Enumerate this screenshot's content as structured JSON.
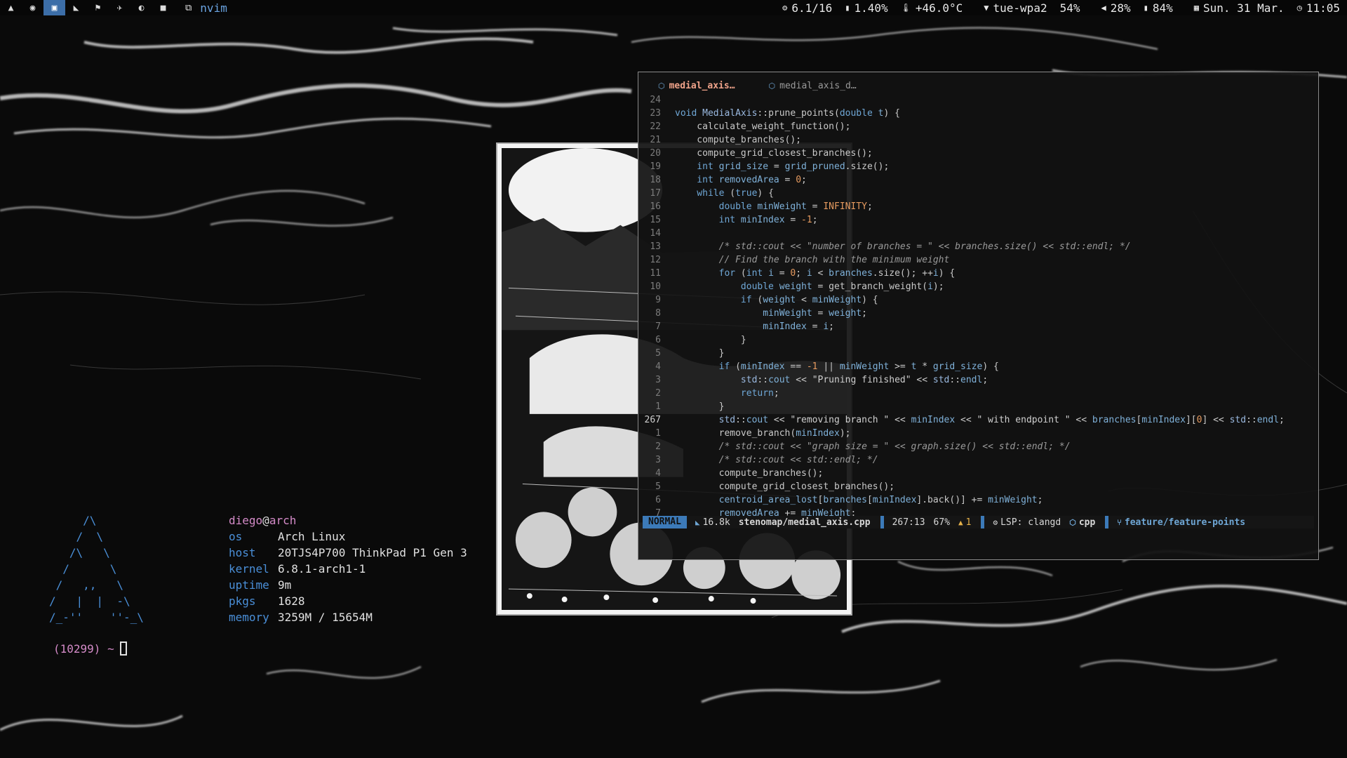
{
  "topbar": {
    "workspaces": [
      {
        "icon": "arch-icon",
        "glyph": "▲",
        "active": false
      },
      {
        "icon": "browser-icon",
        "glyph": "◉",
        "active": false
      },
      {
        "icon": "terminal-icon",
        "glyph": "▣",
        "active": true
      },
      {
        "icon": "kite-icon",
        "glyph": "◣",
        "active": false
      },
      {
        "icon": "flag-icon",
        "glyph": "⚑",
        "active": false
      },
      {
        "icon": "plane-icon",
        "glyph": "✈",
        "active": false
      },
      {
        "icon": "circle-icon",
        "glyph": "◐",
        "active": false
      },
      {
        "icon": "lock-icon",
        "glyph": "■",
        "active": false
      }
    ],
    "window_icon": "⧉",
    "title": "nvim",
    "modules": {
      "load": "6.1/16",
      "cpu": "1.40%",
      "temp": "+46.0°C",
      "wifi": "tue-wpa2",
      "wifi_strength": "54%",
      "volume": "28%",
      "battery": "84%",
      "date": "Sun. 31 Mar.",
      "time": "11:05"
    }
  },
  "neofetch": {
    "logo": "     /\\\n    /  \\\n   /\\   \\\n  /      \\\n /   ,,   \\\n/   |  |  -\\\n/_-''    ''-_\\",
    "user": "diego",
    "at": "@",
    "host_name": "arch",
    "rows": [
      {
        "key": "os",
        "value": "Arch Linux"
      },
      {
        "key": "host",
        "value": "20TJS4P700 ThinkPad P1 Gen 3"
      },
      {
        "key": "kernel",
        "value": "6.8.1-arch1-1"
      },
      {
        "key": "uptime",
        "value": "9m"
      },
      {
        "key": "pkgs",
        "value": "1628"
      },
      {
        "key": "memory",
        "value": "3259M / 15654M"
      }
    ]
  },
  "prompt": {
    "text": "(10299) ~"
  },
  "nvim": {
    "tabs": [
      {
        "label": "medial_axis…",
        "active": true
      },
      {
        "label": "medial_axis_d…",
        "active": false
      }
    ],
    "lines": [
      {
        "n": "24",
        "cur": false,
        "seg": []
      },
      {
        "n": "23",
        "cur": false,
        "seg": [
          [
            "ty",
            "void "
          ],
          [
            "cls",
            "MedialAxis"
          ],
          [
            "fn",
            "::prune_points("
          ],
          [
            "ty",
            "double "
          ],
          [
            "var",
            "t"
          ],
          [
            "fn",
            ") {"
          ]
        ]
      },
      {
        "n": "22",
        "cur": false,
        "seg": [
          [
            "fn",
            "    calculate_weight_function();"
          ]
        ]
      },
      {
        "n": "21",
        "cur": false,
        "seg": [
          [
            "fn",
            "    compute_branches();"
          ]
        ]
      },
      {
        "n": "20",
        "cur": false,
        "seg": [
          [
            "fn",
            "    compute_grid_closest_branches();"
          ]
        ]
      },
      {
        "n": "19",
        "cur": false,
        "seg": [
          [
            "ty",
            "    int "
          ],
          [
            "var",
            "grid_size"
          ],
          [
            "fn",
            " = "
          ],
          [
            "var",
            "grid_pruned"
          ],
          [
            "fn",
            ".size();"
          ]
        ]
      },
      {
        "n": "18",
        "cur": false,
        "seg": [
          [
            "ty",
            "    int "
          ],
          [
            "var",
            "removedArea"
          ],
          [
            "fn",
            " = "
          ],
          [
            "num",
            "0"
          ],
          [
            "fn",
            ";"
          ]
        ]
      },
      {
        "n": "17",
        "cur": false,
        "seg": [
          [
            "kw",
            "    while "
          ],
          [
            "fn",
            "("
          ],
          [
            "kw",
            "true"
          ],
          [
            "fn",
            ") {"
          ]
        ]
      },
      {
        "n": "16",
        "cur": false,
        "seg": [
          [
            "ty",
            "        double "
          ],
          [
            "var",
            "minWeight"
          ],
          [
            "fn",
            " = "
          ],
          [
            "num",
            "INFINITY"
          ],
          [
            "fn",
            ";"
          ]
        ]
      },
      {
        "n": "15",
        "cur": false,
        "seg": [
          [
            "ty",
            "        int "
          ],
          [
            "var",
            "minIndex"
          ],
          [
            "fn",
            " = "
          ],
          [
            "num",
            "-1"
          ],
          [
            "fn",
            ";"
          ]
        ]
      },
      {
        "n": "14",
        "cur": false,
        "seg": []
      },
      {
        "n": "13",
        "cur": false,
        "seg": [
          [
            "cm",
            "        /* std::cout << \"number of branches = \" << branches.size() << std::endl; */"
          ]
        ]
      },
      {
        "n": "12",
        "cur": false,
        "seg": [
          [
            "cm",
            "        // Find the branch with the minimum weight"
          ]
        ]
      },
      {
        "n": "11",
        "cur": false,
        "seg": [
          [
            "kw",
            "        for "
          ],
          [
            "fn",
            "("
          ],
          [
            "ty",
            "int "
          ],
          [
            "var",
            "i"
          ],
          [
            "fn",
            " = "
          ],
          [
            "num",
            "0"
          ],
          [
            "fn",
            "; "
          ],
          [
            "var",
            "i"
          ],
          [
            "fn",
            " < "
          ],
          [
            "var",
            "branches"
          ],
          [
            "fn",
            ".size(); ++"
          ],
          [
            "var",
            "i"
          ],
          [
            "fn",
            ") {"
          ]
        ]
      },
      {
        "n": "10",
        "cur": false,
        "seg": [
          [
            "ty",
            "            double "
          ],
          [
            "var",
            "weight"
          ],
          [
            "fn",
            " = get_branch_weight("
          ],
          [
            "var",
            "i"
          ],
          [
            "fn",
            ");"
          ]
        ]
      },
      {
        "n": "9",
        "cur": false,
        "seg": [
          [
            "kw",
            "            if "
          ],
          [
            "fn",
            "("
          ],
          [
            "var",
            "weight"
          ],
          [
            "fn",
            " < "
          ],
          [
            "var",
            "minWeight"
          ],
          [
            "fn",
            ") {"
          ]
        ]
      },
      {
        "n": "8",
        "cur": false,
        "seg": [
          [
            "var",
            "                minWeight"
          ],
          [
            "fn",
            " = "
          ],
          [
            "var",
            "weight"
          ],
          [
            "fn",
            ";"
          ]
        ]
      },
      {
        "n": "7",
        "cur": false,
        "seg": [
          [
            "var",
            "                minIndex"
          ],
          [
            "fn",
            " = "
          ],
          [
            "var",
            "i"
          ],
          [
            "fn",
            ";"
          ]
        ]
      },
      {
        "n": "6",
        "cur": false,
        "seg": [
          [
            "fn",
            "            }"
          ]
        ]
      },
      {
        "n": "5",
        "cur": false,
        "seg": [
          [
            "fn",
            "        }"
          ]
        ]
      },
      {
        "n": "4",
        "cur": false,
        "seg": [
          [
            "kw",
            "        if "
          ],
          [
            "fn",
            "("
          ],
          [
            "var",
            "minIndex"
          ],
          [
            "fn",
            " == "
          ],
          [
            "num",
            "-1"
          ],
          [
            "fn",
            " || "
          ],
          [
            "var",
            "minWeight"
          ],
          [
            "fn",
            " >= "
          ],
          [
            "var",
            "t"
          ],
          [
            "fn",
            " * "
          ],
          [
            "var",
            "grid_size"
          ],
          [
            "fn",
            ") {"
          ]
        ]
      },
      {
        "n": "3",
        "cur": false,
        "seg": [
          [
            "cls",
            "            std"
          ],
          [
            "fn",
            "::"
          ],
          [
            "var",
            "cout"
          ],
          [
            "fn",
            " << "
          ],
          [
            "str",
            "\"Pruning finished\""
          ],
          [
            "fn",
            " << "
          ],
          [
            "cls",
            "std"
          ],
          [
            "fn",
            "::"
          ],
          [
            "var",
            "endl"
          ],
          [
            "fn",
            ";"
          ]
        ]
      },
      {
        "n": "2",
        "cur": false,
        "seg": [
          [
            "kw",
            "            return"
          ],
          [
            "fn",
            ";"
          ]
        ]
      },
      {
        "n": "1",
        "cur": false,
        "seg": [
          [
            "fn",
            "        }"
          ]
        ]
      },
      {
        "n": "267",
        "cur": true,
        "seg": [
          [
            "cls",
            "        std"
          ],
          [
            "fn",
            "::"
          ],
          [
            "var",
            "cout"
          ],
          [
            "fn",
            " << "
          ],
          [
            "str",
            "\"removing branch \""
          ],
          [
            "fn",
            " << "
          ],
          [
            "var",
            "minIndex"
          ],
          [
            "fn",
            " << "
          ],
          [
            "str",
            "\" with endpoint \""
          ],
          [
            "fn",
            " << "
          ],
          [
            "var",
            "branches"
          ],
          [
            "fn",
            "["
          ],
          [
            "var",
            "minIndex"
          ],
          [
            "fn",
            "]["
          ],
          [
            "num",
            "0"
          ],
          [
            "fn",
            "] << "
          ],
          [
            "cls",
            "std"
          ],
          [
            "fn",
            "::"
          ],
          [
            "var",
            "endl"
          ],
          [
            "fn",
            ";"
          ]
        ]
      },
      {
        "n": "1",
        "cur": false,
        "seg": [
          [
            "fn",
            "        remove_branch("
          ],
          [
            "var",
            "minIndex"
          ],
          [
            "fn",
            ");"
          ]
        ]
      },
      {
        "n": "2",
        "cur": false,
        "seg": [
          [
            "cm",
            "        /* std::cout << \"graph size = \" << graph.size() << std::endl; */"
          ]
        ]
      },
      {
        "n": "3",
        "cur": false,
        "seg": [
          [
            "cm",
            "        /* std::cout << std::endl; */"
          ]
        ]
      },
      {
        "n": "4",
        "cur": false,
        "seg": [
          [
            "fn",
            "        compute_branches();"
          ]
        ]
      },
      {
        "n": "5",
        "cur": false,
        "seg": [
          [
            "fn",
            "        compute_grid_closest_branches();"
          ]
        ]
      },
      {
        "n": "6",
        "cur": false,
        "seg": [
          [
            "var",
            "        centroid_area_lost"
          ],
          [
            "fn",
            "["
          ],
          [
            "var",
            "branches"
          ],
          [
            "fn",
            "["
          ],
          [
            "var",
            "minIndex"
          ],
          [
            "fn",
            "].back()] += "
          ],
          [
            "var",
            "minWeight"
          ],
          [
            "fn",
            ";"
          ]
        ]
      },
      {
        "n": "7",
        "cur": false,
        "seg": [
          [
            "var",
            "        removedArea"
          ],
          [
            "fn",
            " += "
          ],
          [
            "var",
            "minWeight"
          ],
          [
            "fn",
            ";"
          ]
        ]
      }
    ],
    "status": {
      "mode": "NORMAL",
      "size": "16.8k",
      "file": "stenomap/medial_axis.cpp",
      "position": "267:13",
      "percent": "67%",
      "warnings": "1",
      "lsp": "LSP: clangd",
      "filetype": "cpp",
      "branch": "feature/feature-points"
    }
  },
  "colors": {
    "accent": "#3c7ab8",
    "active_tab": "#f0a38a",
    "user": "#d48bc8"
  }
}
